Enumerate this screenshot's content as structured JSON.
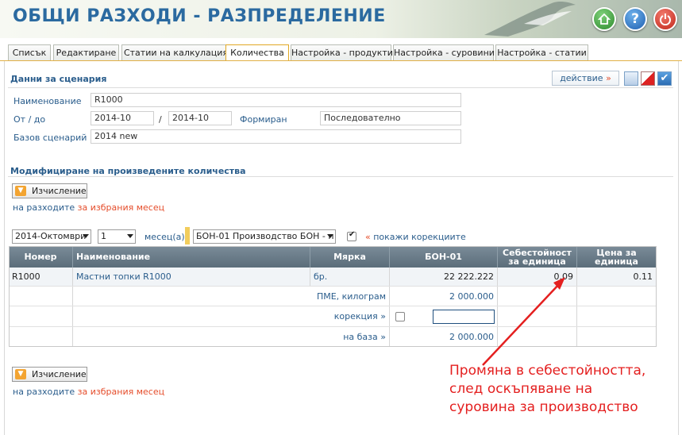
{
  "app": {
    "title": "ОБЩИ РАЗХОДИ - РАЗПРЕДЕЛЕНИЕ"
  },
  "header_buttons": {
    "home": "home-icon",
    "help": "?",
    "power": "power-icon"
  },
  "tabs": [
    {
      "label": "Списък"
    },
    {
      "label": "Редактиране"
    },
    {
      "label": "Статии на калкулация"
    },
    {
      "label": "Количества"
    },
    {
      "label": "Настройка - продукти"
    },
    {
      "label": "Настройка - суровини"
    },
    {
      "label": "Настройка - статии"
    }
  ],
  "scenario": {
    "title": "Данни за сценария",
    "action_label": "действие",
    "action_arrow": "»",
    "name_label": "Наименование",
    "name_value": "R1000",
    "period_label": "От / до",
    "period_from": "2014-10",
    "period_sep": "/",
    "period_to": "2014-10",
    "formed_label": "Формиран",
    "formed_value": "Последователно",
    "base_label": "Базов сценарий",
    "base_value": "2014 new"
  },
  "quantities": {
    "title": "Модифициране на произведените количества",
    "calc_label": "Изчисление",
    "hint_blue": "на разходите ",
    "hint_red": "за избрания месец",
    "month_select": "2014-Октомври",
    "count_select": "1",
    "months_label": "месец(а)",
    "product_select": "БОН-01 Производство БОН - п",
    "show_corrections_arrow": "«",
    "show_corrections": "покажи корекциите"
  },
  "grid": {
    "headers": [
      "Номер",
      "Наименование",
      "Мярка",
      "БОН-01",
      "Себестойност за единица",
      "Цена за единица"
    ],
    "row1": {
      "number": "R1000",
      "name": "Мастни топки R1000",
      "unit": "бр.",
      "bon": "22 222.222",
      "cost": "0.09",
      "price": "0.11"
    },
    "row2": {
      "label": "ПМЕ, килограм",
      "bon": "2 000.000"
    },
    "row3": {
      "label": "корекция »"
    },
    "row4": {
      "label": "на база »",
      "bon": "2 000.000"
    }
  },
  "annotation": {
    "line1": "Промяна в себестойността,",
    "line2": "след оскъпяване на",
    "line3": "суровина за производство"
  },
  "colors": {
    "title_blue": "#2b6aa0",
    "accent_red": "#e41f1f",
    "tab_active": "#e0a825"
  }
}
